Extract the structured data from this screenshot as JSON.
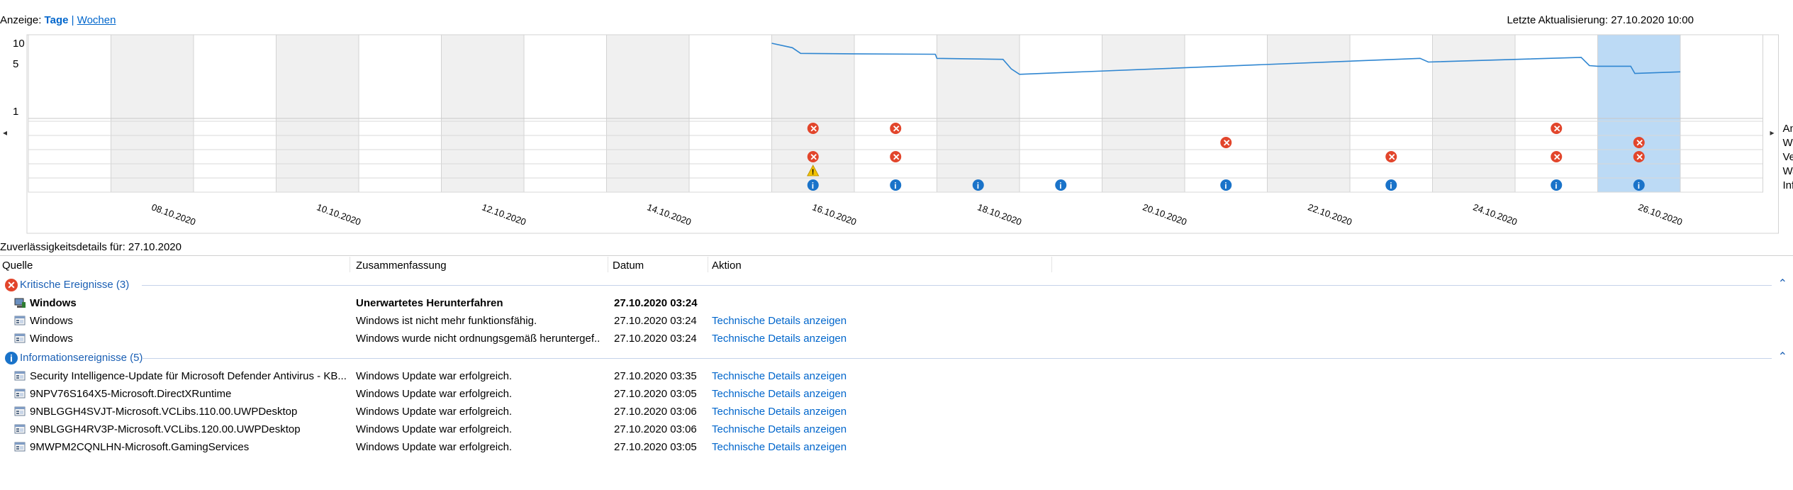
{
  "header": {
    "view_label": "Anzeige:",
    "view_days": "Tage",
    "view_sep": "|",
    "view_weeks": "Wochen",
    "last_update": "Letzte Aktualisierung: 27.10.2020 10:00"
  },
  "chart_data": {
    "type": "line",
    "y_axis_ticks": [
      "10",
      "5",
      "1"
    ],
    "ylim": [
      1,
      10
    ],
    "x_labels": [
      "08.10.2020",
      "10.10.2020",
      "12.10.2020",
      "14.10.2020",
      "16.10.2020",
      "18.10.2020",
      "20.10.2020",
      "22.10.2020",
      "24.10.2020",
      "26.10.2020"
    ],
    "days": [
      "07.10.2020",
      "08.10.2020",
      "09.10.2020",
      "10.10.2020",
      "11.10.2020",
      "12.10.2020",
      "13.10.2020",
      "14.10.2020",
      "15.10.2020",
      "16.10.2020",
      "17.10.2020",
      "18.10.2020",
      "19.10.2020",
      "20.10.2020",
      "21.10.2020",
      "22.10.2020",
      "23.10.2020",
      "24.10.2020",
      "25.10.2020",
      "26.10.2020",
      "27.10.2020"
    ],
    "selected_day_index": 19,
    "stability_index": [
      {
        "day": 9.0,
        "value": 10.0
      },
      {
        "day": 9.25,
        "value": 8.6
      },
      {
        "day": 9.35,
        "value": 7.1
      },
      {
        "day": 10.0,
        "value": 7.0
      },
      {
        "day": 10.98,
        "value": 6.9
      },
      {
        "day": 11.0,
        "value": 6.0
      },
      {
        "day": 11.8,
        "value": 5.8
      },
      {
        "day": 11.9,
        "value": 4.2
      },
      {
        "day": 12.0,
        "value": 3.5
      },
      {
        "day": 16.85,
        "value": 6.0
      },
      {
        "day": 16.95,
        "value": 5.3
      },
      {
        "day": 18.8,
        "value": 6.2
      },
      {
        "day": 18.9,
        "value": 4.7
      },
      {
        "day": 19.0,
        "value": 4.6
      },
      {
        "day": 19.4,
        "value": 4.6
      },
      {
        "day": 19.45,
        "value": 3.6
      },
      {
        "day": 20.0,
        "value": 3.8
      }
    ],
    "categories": [
      "Anwendungsfehler",
      "Windows-Fehler",
      "Verschiedene Fehler",
      "Warnungen",
      "Informationen"
    ],
    "events": {
      "Anwendungsfehler": [
        9,
        10,
        18
      ],
      "Windows-Fehler": [
        14,
        19
      ],
      "Verschiedene Fehler": [
        9,
        10,
        16,
        18,
        19
      ],
      "Warnungen": [
        9
      ],
      "Informationen": [
        9,
        10,
        11,
        12,
        14,
        16,
        18,
        19
      ]
    },
    "colors": {
      "line": "#2f86d1",
      "error": "#e2452b",
      "warning": "#f2c200",
      "info": "#1a73c9",
      "selected": "#bcdaf5",
      "shaded": "#f0f0f0"
    }
  },
  "details": {
    "title": "Zuverlässigkeitsdetails für: 27.10.2020",
    "columns": [
      "Quelle",
      "Zusammenfassung",
      "Datum",
      "Aktion"
    ],
    "groups": [
      {
        "label": "Kritische Ereignisse (3)",
        "icon": "error-icon",
        "rows": [
          {
            "source": "Windows",
            "summary": "Unerwartetes Herunterfahren",
            "date": "27.10.2020 03:24",
            "action": "",
            "bold": true,
            "icon": "windows-computer-icon"
          },
          {
            "source": "Windows",
            "summary": "Windows ist nicht mehr funktionsfähig.",
            "date": "27.10.2020 03:24",
            "action": "Technische Details anzeigen",
            "bold": false,
            "icon": "app-window-icon"
          },
          {
            "source": "Windows",
            "summary": "Windows wurde nicht ordnungsgemäß heruntergef...",
            "date": "27.10.2020 03:24",
            "action": "Technische Details anzeigen",
            "bold": false,
            "icon": "app-window-icon"
          }
        ]
      },
      {
        "label": "Informationsereignisse (5)",
        "icon": "info-icon",
        "rows": [
          {
            "source": "Security Intelligence-Update für Microsoft Defender Antivirus - KB...",
            "summary": "Windows Update war erfolgreich.",
            "date": "27.10.2020 03:35",
            "action": "Technische Details anzeigen",
            "bold": false,
            "icon": "app-window-icon"
          },
          {
            "source": "9NPV76S164X5-Microsoft.DirectXRuntime",
            "summary": "Windows Update war erfolgreich.",
            "date": "27.10.2020 03:05",
            "action": "Technische Details anzeigen",
            "bold": false,
            "icon": "app-window-icon"
          },
          {
            "source": "9NBLGGH4SVJT-Microsoft.VCLibs.110.00.UWPDesktop",
            "summary": "Windows Update war erfolgreich.",
            "date": "27.10.2020 03:06",
            "action": "Technische Details anzeigen",
            "bold": false,
            "icon": "app-window-icon"
          },
          {
            "source": "9NBLGGH4RV3P-Microsoft.VCLibs.120.00.UWPDesktop",
            "summary": "Windows Update war erfolgreich.",
            "date": "27.10.2020 03:06",
            "action": "Technische Details anzeigen",
            "bold": false,
            "icon": "app-window-icon"
          },
          {
            "source": "9MWPM2CQNLHN-Microsoft.GamingServices",
            "summary": "Windows Update war erfolgreich.",
            "date": "27.10.2020 03:05",
            "action": "Technische Details anzeigen",
            "bold": false,
            "icon": "app-window-icon"
          }
        ]
      }
    ]
  }
}
